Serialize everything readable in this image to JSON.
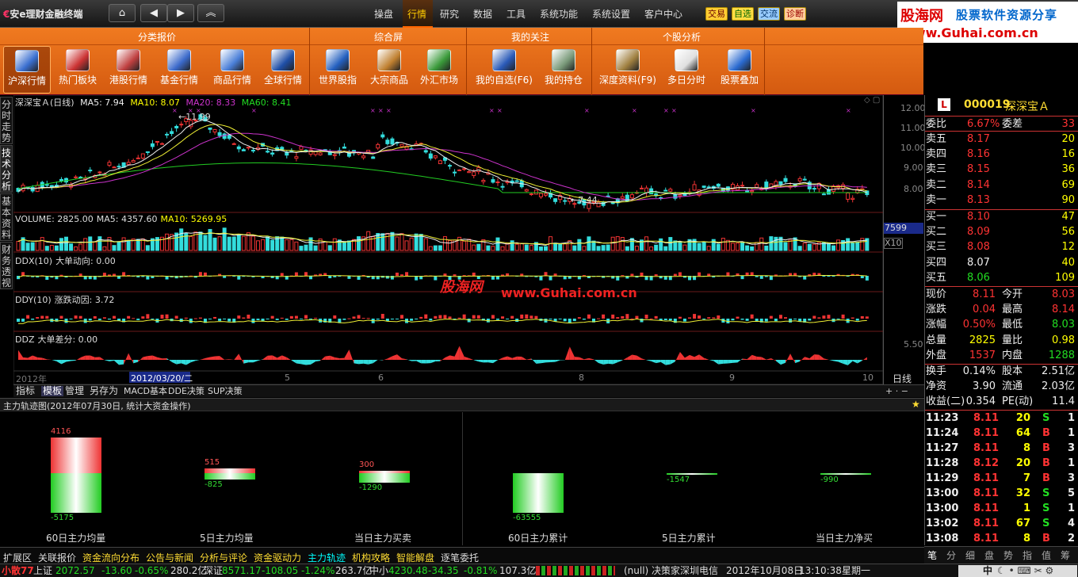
{
  "titlebar": {
    "brand": "安e理财金融终端",
    "menu": [
      "操盘",
      "行情",
      "研究",
      "数据",
      "工具",
      "系统功能",
      "系统设置",
      "客户中心"
    ],
    "active_menu": "行情",
    "quick": [
      "交易",
      "自选",
      "交流",
      "诊断"
    ]
  },
  "ad": {
    "name": "股海网",
    "slogan": "股票软件资源分享",
    "url": "www.Guhai.com.cn"
  },
  "ribbon": {
    "groups": [
      "分类报价",
      "综合屏",
      "我的关注",
      "个股分析"
    ],
    "tools": [
      {
        "label": "沪深行情",
        "selected": true,
        "color": "#3a6fd0"
      },
      {
        "label": "热门板块",
        "color": "#cc3333"
      },
      {
        "label": "港股行情",
        "color": "#c04040"
      },
      {
        "label": "基金行情",
        "color": "#3b6acb"
      },
      {
        "label": "商品行情",
        "color": "#4a7fd8"
      },
      {
        "label": "全球行情",
        "color": "#1f4fa8"
      },
      {
        "label": "世界股指",
        "color": "#2460c0"
      },
      {
        "label": "大宗商品",
        "color": "#c08030"
      },
      {
        "label": "外汇市场",
        "color": "#3a9a3a"
      },
      {
        "label": "我的自选(F6)",
        "color": "#2a5ab8"
      },
      {
        "label": "我的持仓",
        "color": "#7a9a7a"
      },
      {
        "label": "深度资料(F9)",
        "color": "#a08040"
      },
      {
        "label": "多日分时",
        "color": "#e0e0e0"
      },
      {
        "label": "股票叠加",
        "color": "#2a6ad0"
      }
    ]
  },
  "vtabs": [
    "分时走势",
    "技术分析",
    "基本资料",
    "财务透视"
  ],
  "kline": {
    "name": "深深宝Ａ",
    "period": "(日线)",
    "ma5": "MA5: 7.94",
    "ma10": "MA10: 8.07",
    "ma20": "MA20: 8.33",
    "ma60": "MA60: 8.41",
    "high_mark": "11.99",
    "low_mark": "7.44",
    "yticks": [
      "12.00",
      "11.00",
      "10.00",
      "9.00",
      "8.00"
    ]
  },
  "volume": {
    "label": "VOLUME: 2825.00",
    "ma5": "MA5: 4357.60",
    "ma10": "MA10: 5269.95",
    "box": "7599",
    "unit": "X10"
  },
  "ddx": {
    "label": "DDX(10)",
    "sub": "大单动向: 0.00"
  },
  "ddy": {
    "label": "DDY(10)",
    "sub": "涨跌动因: 3.72"
  },
  "ddz": {
    "label": "DDZ",
    "sub": "大单差分: 0.00",
    "ytick": "5.50"
  },
  "watermark": {
    "a": "股海网",
    "b": "www.Guhai.com.cn"
  },
  "xaxis": {
    "year": "2012年",
    "cursor_date": "2012/03/20/二",
    "months": [
      "5",
      "6",
      "8",
      "9",
      "10"
    ],
    "period": "日线"
  },
  "indtabs": [
    "指标",
    "模板",
    "管理",
    "另存为",
    "MACD基本",
    "DDE决策",
    "SUP决策"
  ],
  "active_indtab": "模板",
  "flow": {
    "title": "主力轨迹图(2012年07月30日, 统计大资金操作)",
    "items": [
      {
        "label": "60日主力均量",
        "pos": "4116",
        "neg": "-5175"
      },
      {
        "label": "5日主力均量",
        "pos": "515",
        "neg": "-825"
      },
      {
        "label": "当日主力买卖",
        "pos": "300",
        "neg": "-1290"
      },
      {
        "label": "60日主力累计",
        "pos": "",
        "neg": "-63555"
      },
      {
        "label": "5日主力累计",
        "pos": "",
        "neg": "-1547"
      },
      {
        "label": "当日主力净买",
        "pos": "",
        "neg": "-990"
      }
    ]
  },
  "bottomtabs": [
    "扩展区",
    "关联报价",
    "资金流向分布",
    "公告与新闻",
    "分析与评论",
    "资金驱动力",
    "主力轨迹",
    "机构攻略",
    "智能解盘",
    "逐笔委托"
  ],
  "active_bottomtab": "主力轨迹",
  "quote": {
    "logo": "L",
    "code": "000019",
    "name": "深深宝Ａ",
    "webi": {
      "k": "委比",
      "v": "6.67%",
      "k2": "委差",
      "v2": "33"
    },
    "sells": [
      {
        "k": "卖五",
        "p": "8.17",
        "v": "20"
      },
      {
        "k": "卖四",
        "p": "8.16",
        "v": "16"
      },
      {
        "k": "卖三",
        "p": "8.15",
        "v": "36"
      },
      {
        "k": "卖二",
        "p": "8.14",
        "v": "69"
      },
      {
        "k": "卖一",
        "p": "8.13",
        "v": "90"
      }
    ],
    "buys": [
      {
        "k": "买一",
        "p": "8.10",
        "v": "47"
      },
      {
        "k": "买二",
        "p": "8.09",
        "v": "56"
      },
      {
        "k": "买三",
        "p": "8.08",
        "v": "12"
      },
      {
        "k": "买四",
        "p": "8.07",
        "v": "40"
      },
      {
        "k": "买五",
        "p": "8.06",
        "v": "109"
      }
    ],
    "stats": [
      {
        "k": "现价",
        "v": "8.11",
        "k2": "今开",
        "v2": "8.03"
      },
      {
        "k": "涨跌",
        "v": "0.04",
        "k2": "最高",
        "v2": "8.14"
      },
      {
        "k": "涨幅",
        "v": "0.50%",
        "k2": "最低",
        "v2": "8.03"
      },
      {
        "k": "总量",
        "v": "2825",
        "k2": "量比",
        "v2": "0.98"
      },
      {
        "k": "外盘",
        "v": "1537",
        "k2": "内盘",
        "v2": "1288"
      }
    ],
    "stats2": [
      {
        "k": "换手",
        "v": "0.14%",
        "k2": "股本",
        "v2": "2.51亿"
      },
      {
        "k": "净资",
        "v": "3.90",
        "k2": "流通",
        "v2": "2.03亿"
      },
      {
        "k": "收益(二)",
        "v": "0.354",
        "k2": "PE(动)",
        "v2": "11.4"
      }
    ],
    "ticks": [
      {
        "t": "11:23",
        "p": "8.11",
        "v": "20",
        "s": "S",
        "n": "1"
      },
      {
        "t": "11:24",
        "p": "8.11",
        "v": "64",
        "s": "B",
        "n": "1"
      },
      {
        "t": "11:27",
        "p": "8.11",
        "v": "8",
        "s": "B",
        "n": "3"
      },
      {
        "t": "11:28",
        "p": "8.12",
        "v": "20",
        "s": "B",
        "n": "1"
      },
      {
        "t": "11:29",
        "p": "8.11",
        "v": "7",
        "s": "B",
        "n": "3"
      },
      {
        "t": "13:00",
        "p": "8.11",
        "v": "32",
        "s": "S",
        "n": "5"
      },
      {
        "t": "13:00",
        "p": "8.11",
        "v": "1",
        "s": "S",
        "n": "1"
      },
      {
        "t": "13:02",
        "p": "8.11",
        "v": "67",
        "s": "S",
        "n": "4"
      },
      {
        "t": "13:08",
        "p": "8.11",
        "v": "8",
        "s": "B",
        "n": "2"
      }
    ],
    "ptabs": [
      "笔",
      "分",
      "细",
      "盘",
      "势",
      "指",
      "值",
      "筹"
    ]
  },
  "status": {
    "badge": "小散77",
    "sh": {
      "name": "上证",
      "last": "2072.57",
      "chg": "-13.60",
      "pct": "-0.65%",
      "amt": "280.2亿"
    },
    "sz": {
      "name": "深证",
      "last": "8571.17",
      "chg": "-108.05",
      "pct": "-1.24%",
      "amt": "263.7亿"
    },
    "zx": {
      "name": "中小",
      "last": "4230.48",
      "chg": "-34.35",
      "pct": "-0.81%",
      "amt": "107.3亿"
    },
    "msg": "(null) 决策家深圳电信",
    "date": "2012年10月08日",
    "time": "13:10:38",
    "weekday": "星期一",
    "ime": "中"
  }
}
